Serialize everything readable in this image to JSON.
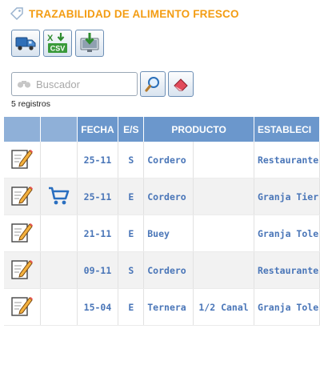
{
  "header": {
    "title": "TRAZABILIDAD DE ALIMENTO FRESCO"
  },
  "toolbar": {
    "buttons": [
      {
        "icon": "truck-icon"
      },
      {
        "icon": "excel-csv-icon",
        "csv_label": "CSV"
      },
      {
        "icon": "monitor-download-icon"
      }
    ]
  },
  "search": {
    "placeholder": "Buscador",
    "value": "",
    "count_label": "5 registros"
  },
  "table": {
    "columns": [
      "",
      "",
      "FECHA",
      "E/S",
      "PRODUCTO",
      "",
      "ESTABLECI"
    ],
    "rows": [
      {
        "cart": false,
        "fecha": "25-11",
        "es": "S",
        "producto": "Cordero",
        "cantidad": "",
        "establecimiento": "Restaurante"
      },
      {
        "cart": true,
        "fecha": "25-11",
        "es": "E",
        "producto": "Cordero",
        "cantidad": "",
        "establecimiento": "Granja Tier"
      },
      {
        "cart": false,
        "fecha": "21-11",
        "es": "E",
        "producto": "Buey",
        "cantidad": "",
        "establecimiento": "Granja Tole"
      },
      {
        "cart": false,
        "fecha": "09-11",
        "es": "S",
        "producto": "Cordero",
        "cantidad": "",
        "establecimiento": "Restaurante"
      },
      {
        "cart": false,
        "fecha": "15-04",
        "es": "E",
        "producto": "Ternera",
        "cantidad": "1/2 Canal",
        "establecimiento": "Granja Tole"
      }
    ]
  },
  "colors": {
    "title": "#f39c12",
    "header_bg": "#6b97cc",
    "link": "#4a76b8"
  }
}
